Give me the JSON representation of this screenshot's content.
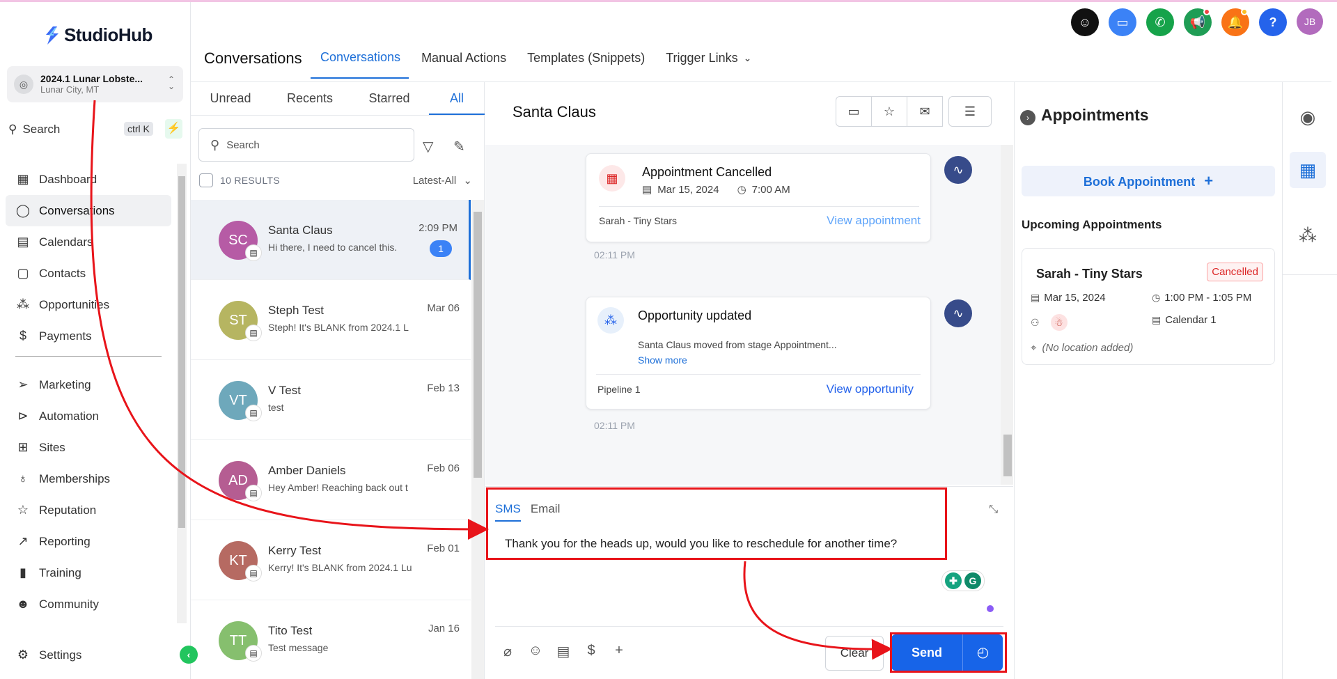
{
  "brand": {
    "name": "StudioHub",
    "accent": "#1d6fd8"
  },
  "location": {
    "name": "2024.1 Lunar Lobste...",
    "city": "Lunar City, MT"
  },
  "sidebar_search": {
    "label": "Search",
    "shortcut": "ctrl K"
  },
  "nav": {
    "primary": [
      {
        "label": "Dashboard",
        "icon": "grid-icon"
      },
      {
        "label": "Conversations",
        "icon": "chat-bubble-icon",
        "active": true
      },
      {
        "label": "Calendars",
        "icon": "calendar-icon"
      },
      {
        "label": "Contacts",
        "icon": "contacts-icon"
      },
      {
        "label": "Opportunities",
        "icon": "network-icon"
      },
      {
        "label": "Payments",
        "icon": "dollar-doc-icon"
      }
    ],
    "secondary": [
      {
        "label": "Marketing",
        "icon": "send-icon"
      },
      {
        "label": "Automation",
        "icon": "play-circle-icon"
      },
      {
        "label": "Sites",
        "icon": "globe-box-icon"
      },
      {
        "label": "Memberships",
        "icon": "award-icon"
      },
      {
        "label": "Reputation",
        "icon": "star-icon"
      },
      {
        "label": "Reporting",
        "icon": "trend-icon"
      },
      {
        "label": "Training",
        "icon": "book-icon"
      },
      {
        "label": "Community",
        "icon": "users-icon"
      }
    ],
    "settings": {
      "label": "Settings",
      "icon": "gear-icon"
    }
  },
  "header": {
    "title": "Conversations",
    "tabs": [
      "Conversations",
      "Manual Actions",
      "Templates (Snippets)",
      "Trigger Links"
    ],
    "avatar_initials": "JB"
  },
  "list": {
    "filter_tabs": [
      "Unread",
      "Recents",
      "Starred",
      "All"
    ],
    "search_placeholder": "Search",
    "results": "10 RESULTS",
    "sort": "Latest-All",
    "conversations": [
      {
        "initials": "SC",
        "name": "Santa Claus",
        "preview": "Hi there, I need to cancel this.",
        "time": "2:09 PM",
        "unread": "1",
        "color": "#b65ba5"
      },
      {
        "initials": "ST",
        "name": "Steph Test",
        "preview": "Steph! It's BLANK from 2024.1 L",
        "time": "Mar 06",
        "color": "#b6b561"
      },
      {
        "initials": "VT",
        "name": "V Test",
        "preview": "test",
        "time": "Feb 13",
        "color": "#6ea8bb"
      },
      {
        "initials": "AD",
        "name": "Amber Daniels",
        "preview": "Hey Amber! Reaching back out t",
        "time": "Feb 06",
        "color": "#b55d92"
      },
      {
        "initials": "KT",
        "name": "Kerry Test",
        "preview": "Kerry! It's BLANK from 2024.1 Lu",
        "time": "Feb 01",
        "color": "#b66a62"
      },
      {
        "initials": "TT",
        "name": "Tito Test",
        "preview": "Test message",
        "time": "Jan 16",
        "color": "#86bf6e"
      }
    ]
  },
  "chat": {
    "contact_name": "Santa Claus",
    "cards": {
      "appointment": {
        "title": "Appointment Cancelled",
        "date": "Mar 15, 2024",
        "time": "7:00 AM",
        "footer_left": "Sarah - Tiny Stars",
        "footer_link": "View appointment",
        "stamp": "02:11 PM"
      },
      "opportunity": {
        "title": "Opportunity updated",
        "body": "Santa Claus moved from stage Appointment...",
        "show_more": "Show more",
        "footer_left": "Pipeline 1",
        "footer_link": "View opportunity",
        "stamp": "02:11 PM"
      }
    },
    "composer": {
      "tabs": [
        "SMS",
        "Email"
      ],
      "message": "Thank you for the heads up, would you like to reschedule for another time?",
      "clear_label": "Clear",
      "send_label": "Send"
    }
  },
  "appointments": {
    "title": "Appointments",
    "book_label": "Book Appointment",
    "upcoming_label": "Upcoming Appointments",
    "card": {
      "name": "Sarah - Tiny Stars",
      "status": "Cancelled",
      "date": "Mar 15, 2024",
      "time": "1:00 PM - 1:05 PM",
      "calendar": "Calendar 1",
      "location": "(No location added)"
    }
  }
}
